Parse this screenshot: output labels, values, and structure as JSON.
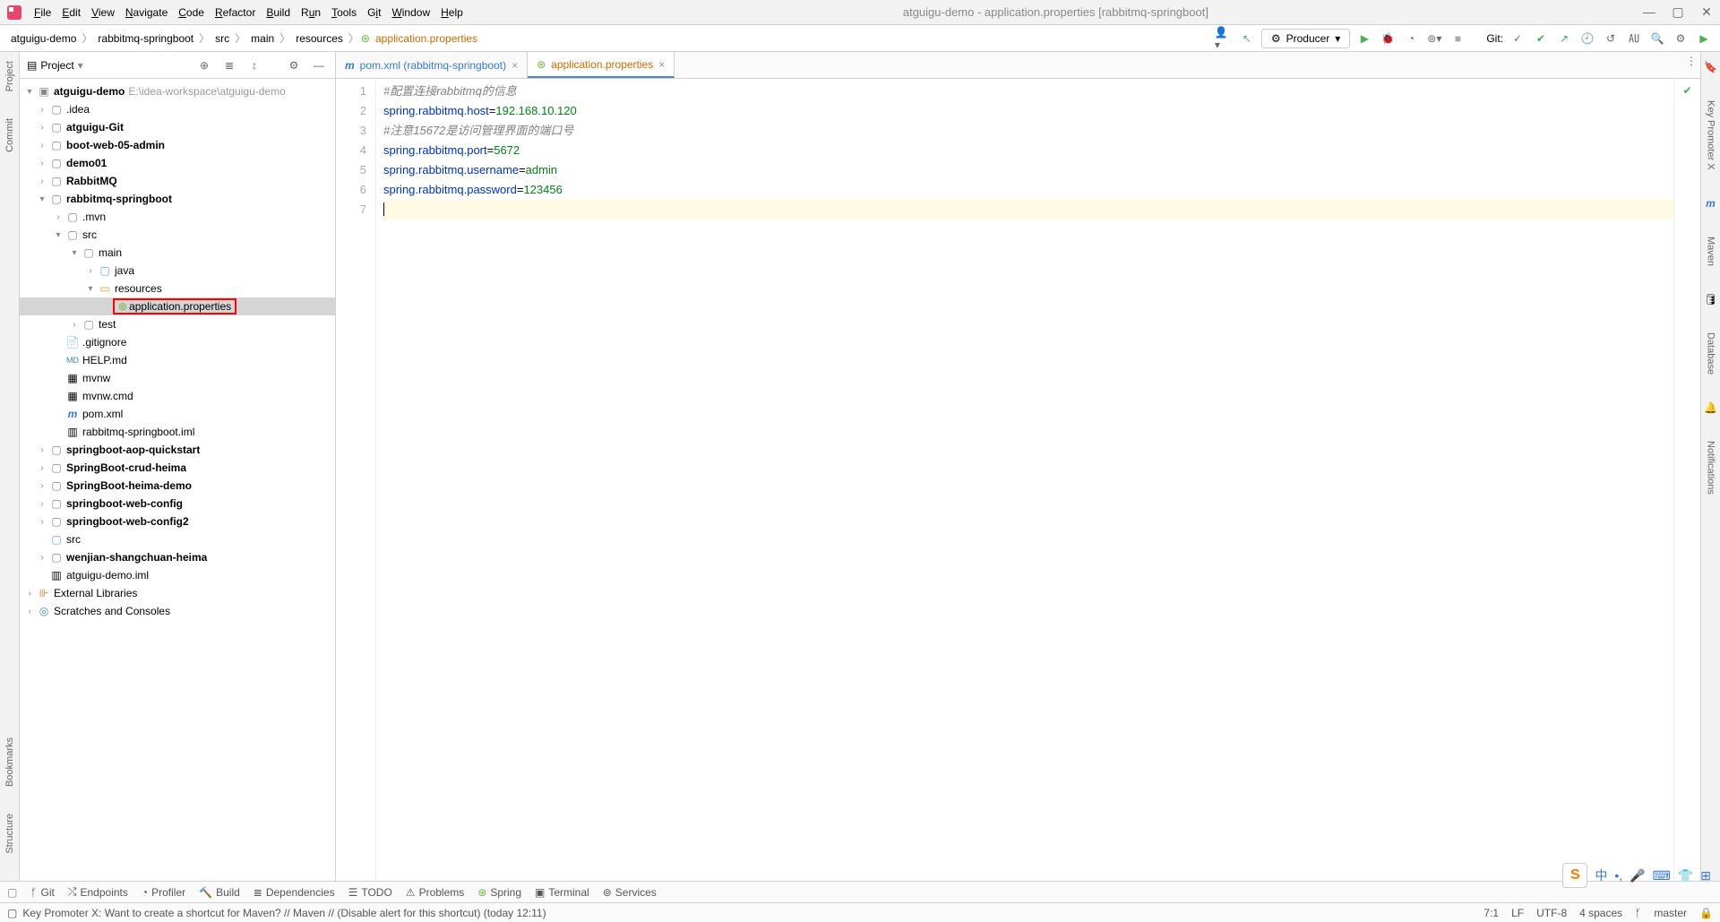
{
  "window_title": "atguigu-demo - application.properties [rabbitmq-springboot]",
  "menu": {
    "file": "File",
    "edit": "Edit",
    "view": "View",
    "navigate": "Navigate",
    "code": "Code",
    "refactor": "Refactor",
    "build": "Build",
    "run": "Run",
    "tools": "Tools",
    "git": "Git",
    "window": "Window",
    "help": "Help"
  },
  "breadcrumbs": {
    "b0": "atguigu-demo",
    "b1": "rabbitmq-springboot",
    "b2": "src",
    "b3": "main",
    "b4": "resources",
    "b5": "application.properties"
  },
  "run_config": "Producer",
  "git_label": "Git:",
  "panel": {
    "title": "Project"
  },
  "left_rail": {
    "project": "Project",
    "commit": "Commit",
    "bookmarks": "Bookmarks",
    "structure": "Structure"
  },
  "right_rail": {
    "keypromoter": "Key Promoter X",
    "maven": "Maven",
    "database": "Database",
    "notifications": "Notifications"
  },
  "tree": {
    "root": "atguigu-demo",
    "root_path": "E:\\idea-workspace\\atguigu-demo",
    "idea_folder": ".idea",
    "atguigu_git": "atguigu-Git",
    "boot_web": "boot-web-05-admin",
    "demo01": "demo01",
    "rabbitmq_mod": "RabbitMQ",
    "rabbitmq_sb": "rabbitmq-springboot",
    "mvn": ".mvn",
    "src": "src",
    "main": "main",
    "java": "java",
    "resources": "resources",
    "app_props": "application.properties",
    "test": "test",
    "gitignore": ".gitignore",
    "help": "HELP.md",
    "mvnw": "mvnw",
    "mvnw_cmd": "mvnw.cmd",
    "pom": "pom.xml",
    "iml": "rabbitmq-springboot.iml",
    "aop": "springboot-aop-quickstart",
    "crud": "SpringBoot-crud-heima",
    "heima": "SpringBoot-heima-demo",
    "webconfig": "springboot-web-config",
    "webconfig2": "springboot-web-config2",
    "src2": "src",
    "wenjian": "wenjian-shangchuan-heima",
    "demo_iml": "atguigu-demo.iml",
    "ext_lib": "External Libraries",
    "scratch": "Scratches and Consoles"
  },
  "tabs": {
    "pom": "pom.xml (rabbitmq-springboot)",
    "props": "application.properties"
  },
  "code": {
    "l1": "#配置连接rabbitmq的信息",
    "l2_k": "spring.rabbitmq.host",
    "l2_v": "192.168.10.120",
    "l3": "#注意15672是访问管理界面的端口号",
    "l4_k": "spring.rabbitmq.port",
    "l4_v": "5672",
    "l5_k": "spring.rabbitmq.username",
    "l5_v": "admin",
    "l6_k": "spring.rabbitmq.password",
    "l6_v": "123456"
  },
  "bottom": {
    "git": "Git",
    "endpoints": "Endpoints",
    "profiler": "Profiler",
    "build": "Build",
    "deps": "Dependencies",
    "todo": "TODO",
    "problems": "Problems",
    "spring": "Spring",
    "terminal": "Terminal",
    "services": "Services"
  },
  "status": {
    "msg": "Key Promoter X: Want to create a shortcut for Maven? // Maven // (Disable alert for this shortcut) (today 12:11)",
    "pos": "7:1",
    "lf": "LF",
    "enc": "UTF-8",
    "indent": "4 spaces",
    "branch": "master"
  }
}
